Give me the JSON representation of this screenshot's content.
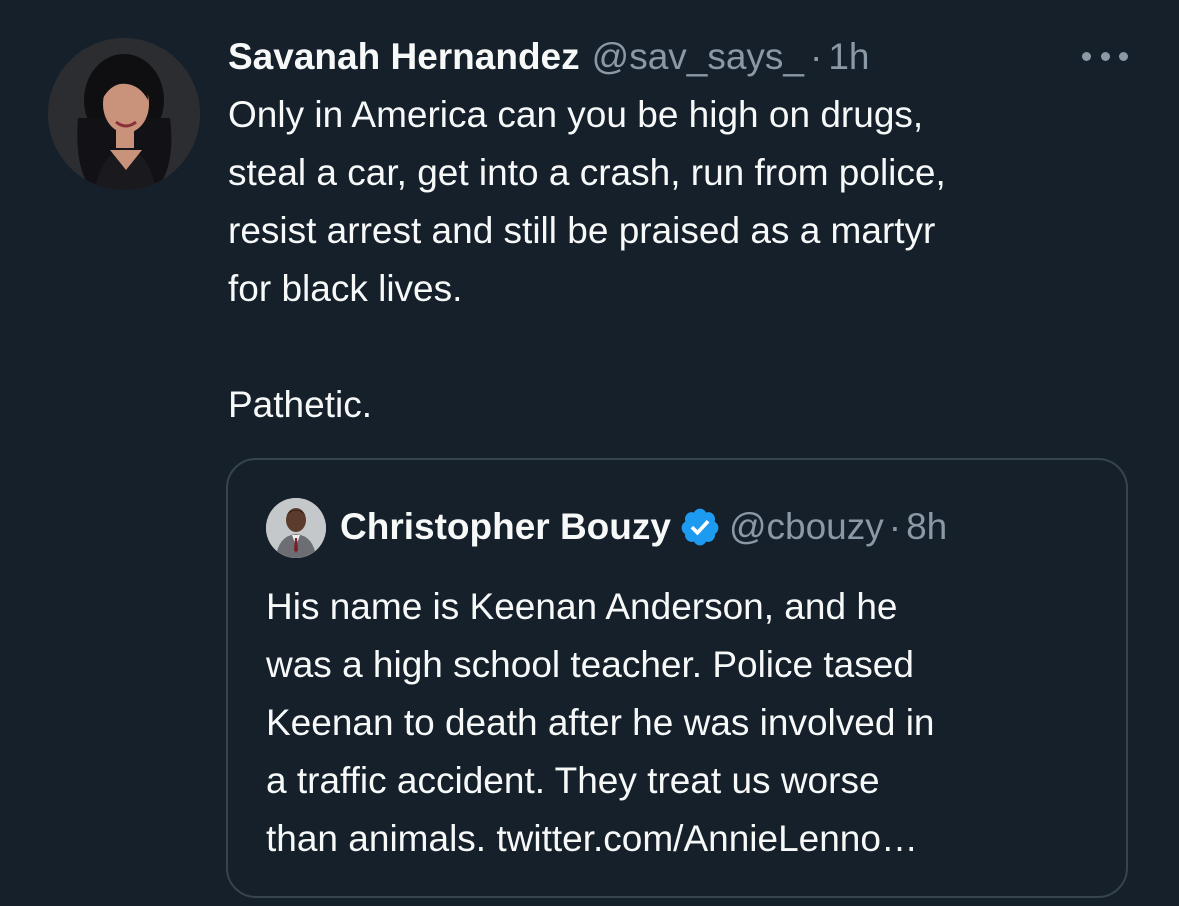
{
  "tweet": {
    "author_name": "Savanah Hernandez",
    "author_handle": "@sav_says_",
    "separator": "·",
    "time": "1h",
    "text_lines": [
      "Only in America can you be high on drugs,",
      "steal a car, get into a crash, run from police,",
      "resist arrest and still be praised as a martyr",
      "for black lives."
    ],
    "text_closing": "Pathetic.",
    "more_icon": "more-horizontal-icon",
    "avatar_icon": "profile-photo"
  },
  "quoted_tweet": {
    "author_name": "Christopher Bouzy",
    "verified_icon": "verified-badge-icon",
    "author_handle": "@cbouzy",
    "separator": "·",
    "time": "8h",
    "text_lines": [
      "His name is Keenan Anderson, and he",
      "was a high school teacher. Police tased",
      "Keenan to death after he was involved in",
      "a traffic accident. They treat us worse",
      "than animals. twitter.com/AnnieLenno…"
    ],
    "avatar_icon": "profile-photo"
  },
  "colors": {
    "background": "#15202b",
    "primary_text": "#f7f9f9",
    "secondary_text": "#8b98a5",
    "border": "#38444d",
    "verified_blue": "#1d9bf0"
  }
}
